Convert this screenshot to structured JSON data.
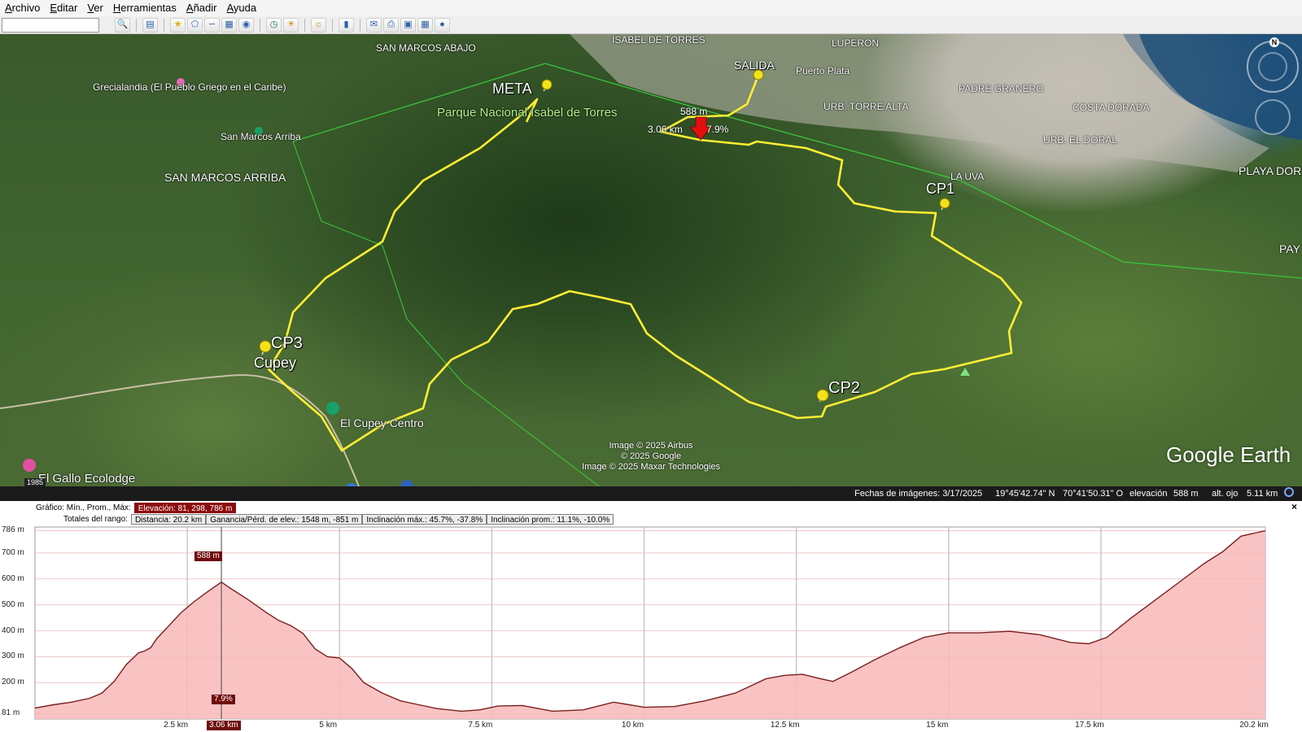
{
  "menu": [
    "Archivo",
    "Editar",
    "Ver",
    "Herramientas",
    "Añadir",
    "Ayuda"
  ],
  "search": {
    "value": ""
  },
  "toolbar": {
    "groups": [
      [
        "search-icon"
      ],
      [
        "sidebar-icon"
      ],
      [
        "placemark-icon",
        "polygon-icon",
        "path-icon",
        "overlay-icon",
        "tour-icon"
      ],
      [
        "history-icon",
        "sun-icon"
      ],
      [
        "planets-icon"
      ],
      [
        "ruler-icon"
      ],
      [
        "email-icon",
        "print-icon",
        "save-image-icon",
        "maps-icon",
        "web-icon"
      ]
    ]
  },
  "map": {
    "places": [
      {
        "name": "ISABEL DE TORRES",
        "style": "normal"
      },
      {
        "name": "SAN MARCOS ABAJO",
        "style": "normal"
      },
      {
        "name": "LUPERON",
        "style": "normal"
      },
      {
        "name": "Grecialandia (El Pueblo Griego en el Caribe)",
        "style": "normal"
      },
      {
        "name": "San Marcos Arriba",
        "style": "normal"
      },
      {
        "name": "SAN MARCOS ARRIBA",
        "style": "big"
      },
      {
        "name": "Parque Nacional Isabel de Torres",
        "style": "park"
      },
      {
        "name": "Puerto Plata",
        "style": "normal"
      },
      {
        "name": "PADRE GRANERO",
        "style": "normal"
      },
      {
        "name": "URB. TORRE ALTA",
        "style": "normal"
      },
      {
        "name": "COSTA DORADA",
        "style": "normal"
      },
      {
        "name": "URB. EL DORAL",
        "style": "normal"
      },
      {
        "name": "LA UVA",
        "style": "normal"
      },
      {
        "name": "PLAYA DOR",
        "style": "big"
      },
      {
        "name": "PAY",
        "style": "big"
      },
      {
        "name": "El Cupey Centro",
        "style": "big"
      },
      {
        "name": "El Gallo Ecolodge",
        "style": "big"
      }
    ],
    "pins": [
      "META",
      "SALIDA",
      "CP1",
      "CP2",
      "CP3",
      "Cupey"
    ],
    "cursor_info": {
      "elevation": "588 m",
      "distance": "3.06 km",
      "slope": "7.9%"
    },
    "copyright": [
      "Image © 2025 Airbus",
      "© 2025 Google",
      "Image © 2025 Maxar Technologies"
    ],
    "logo": "Google Earth",
    "compass_letter": "N",
    "year_badge": "1985"
  },
  "status": {
    "imagery_date": "Fechas de imágenes: 3/17/2025",
    "lat": "19°45'42.74\" N",
    "lon": "70°41'50.31\" O",
    "elev_label": "elevación",
    "elev_value": "588 m",
    "eye_label": "alt. ojo",
    "eye_value": "5.11 km"
  },
  "profile": {
    "row1_label": "Gráfico: Mín., Prom., Máx:",
    "row1_value": "Elevación: 81, 298, 786 m",
    "row2_label": "Totales del rango:",
    "row2_cells": [
      "Distancia: 20.2 km",
      "Ganancia/Pérd. de elev.: 1548 m, -851 m",
      "Inclinación máx.: 45.7%, -37.8%",
      "Inclinación prom.: 11.1%, -10.0%"
    ],
    "close": "×",
    "marker_elev": "588 m",
    "marker_slope": "7.9%",
    "marker_dist": "3.06 km"
  },
  "chart_data": {
    "type": "area",
    "title": "",
    "xlabel": "",
    "ylabel": "",
    "x_unit": "km",
    "y_unit": "m",
    "xlim": [
      0,
      20.2
    ],
    "ylim": [
      60,
      800
    ],
    "y_ticks": [
      "81 m",
      "200 m",
      "300 m",
      "400 m",
      "500 m",
      "600 m",
      "700 m",
      "786 m"
    ],
    "y_tick_values": [
      81,
      200,
      300,
      400,
      500,
      600,
      700,
      786
    ],
    "x_ticks": [
      "2.5 km",
      "5 km",
      "7.5 km",
      "10 km",
      "12.5 km",
      "15 km",
      "17.5 km",
      "20.2 km"
    ],
    "x_tick_values": [
      2.5,
      5,
      7.5,
      10,
      12.5,
      15,
      17.5,
      20.2
    ],
    "color": "#7a1f1f",
    "fill": "#f8b9b9",
    "marker_x": 3.06,
    "x": [
      0,
      0.3,
      0.6,
      0.9,
      1.1,
      1.3,
      1.5,
      1.7,
      1.8,
      1.9,
      2.0,
      2.2,
      2.4,
      2.6,
      2.8,
      3.0,
      3.06,
      3.2,
      3.5,
      3.8,
      4.0,
      4.2,
      4.4,
      4.6,
      4.8,
      5.0,
      5.2,
      5.4,
      5.7,
      6.0,
      6.3,
      6.6,
      7.0,
      7.3,
      7.6,
      8.0,
      8.5,
      9.0,
      9.5,
      10.0,
      10.5,
      11.0,
      11.5,
      12.0,
      12.3,
      12.6,
      12.9,
      13.1,
      13.4,
      13.8,
      14.2,
      14.6,
      15.0,
      15.5,
      16.0,
      16.5,
      17.0,
      17.3,
      17.6,
      18.0,
      18.4,
      18.8,
      19.2,
      19.5,
      19.8,
      20.2
    ],
    "y": [
      102,
      115,
      125,
      140,
      160,
      205,
      270,
      315,
      322,
      335,
      370,
      420,
      470,
      510,
      545,
      578,
      588,
      565,
      520,
      470,
      440,
      420,
      390,
      330,
      300,
      295,
      255,
      200,
      160,
      130,
      115,
      100,
      90,
      95,
      110,
      112,
      90,
      95,
      125,
      105,
      108,
      130,
      160,
      215,
      228,
      232,
      215,
      205,
      240,
      290,
      335,
      375,
      392,
      392,
      398,
      385,
      355,
      350,
      375,
      450,
      520,
      590,
      660,
      705,
      765,
      786
    ]
  }
}
